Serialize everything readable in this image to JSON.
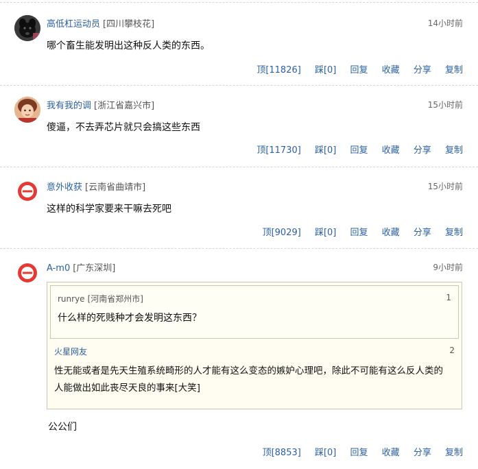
{
  "comments": [
    {
      "user": "高低杠运动员",
      "location": "[四川攀枝花]",
      "time": "14小时前",
      "text": "哪个畜生能发明出这种反人类的东西。",
      "up": "顶[11826]",
      "down": "踩[0]",
      "reply": "回复",
      "fav": "收藏",
      "share": "分享",
      "copy": "复制"
    },
    {
      "user": "我有我的调",
      "location": "[浙江省嘉兴市]",
      "time": "15小时前",
      "text": "傻逼，不去弄芯片就只会搞这些东西",
      "up": "顶[11730]",
      "down": "踩[0]",
      "reply": "回复",
      "fav": "收藏",
      "share": "分享",
      "copy": "复制"
    },
    {
      "user": "意外收获",
      "location": "[云南省曲靖市]",
      "time": "15小时前",
      "text": "这样的科学家要来干嘛去死吧",
      "up": "顶[9029]",
      "down": "踩[0]",
      "reply": "回复",
      "fav": "收藏",
      "share": "分享",
      "copy": "复制"
    },
    {
      "user": "A-m0",
      "location": "[广东深圳]",
      "time": "9小时前",
      "quotes": [
        {
          "user": "runrye",
          "location": "[河南省郑州市]",
          "num": "1",
          "text": "什么样的死贱种才会发明这东西？"
        },
        {
          "user": "火星网友",
          "location": "",
          "num": "2",
          "text_line1": "性无能或者是先天生殖系统畸形的人才能有这么变态的嫉妒心理吧，除此不可能有这么反人类的",
          "text_line2": "人能做出如此丧尽天良的事来[大笑]"
        }
      ],
      "text": "公公们",
      "up": "顶[8853]",
      "down": "踩[0]",
      "reply": "回复",
      "fav": "收藏",
      "share": "分享",
      "copy": "复制"
    }
  ],
  "colors": {
    "link": "#2a5fa3",
    "quote_bg": "#fffdf2",
    "separator": "#cfd6e0"
  },
  "avatars": [
    "black-dog-avatar",
    "cartoon-girl-avatar",
    "app-logo-avatar",
    "app-logo-avatar"
  ]
}
